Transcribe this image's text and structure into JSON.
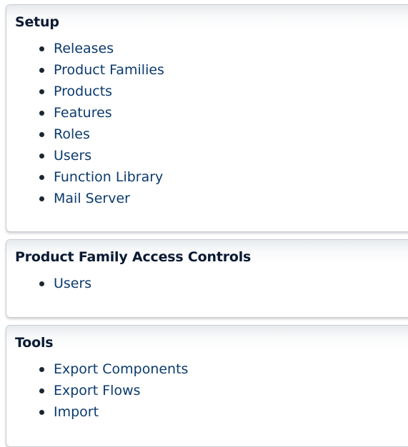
{
  "panels": {
    "setup": {
      "title": "Setup",
      "items": [
        {
          "label": "Releases"
        },
        {
          "label": "Product Families"
        },
        {
          "label": "Products"
        },
        {
          "label": "Features"
        },
        {
          "label": "Roles"
        },
        {
          "label": "Users"
        },
        {
          "label": "Function Library"
        },
        {
          "label": "Mail Server"
        }
      ]
    },
    "access": {
      "title": "Product Family Access Controls",
      "items": [
        {
          "label": "Users"
        }
      ]
    },
    "tools": {
      "title": "Tools",
      "items": [
        {
          "label": "Export Components"
        },
        {
          "label": "Export Flows"
        },
        {
          "label": "Import"
        }
      ]
    }
  },
  "colors": {
    "link": "#0b3a6e",
    "heading": "#0b1a33",
    "panel_border": "#c9cdd2"
  }
}
